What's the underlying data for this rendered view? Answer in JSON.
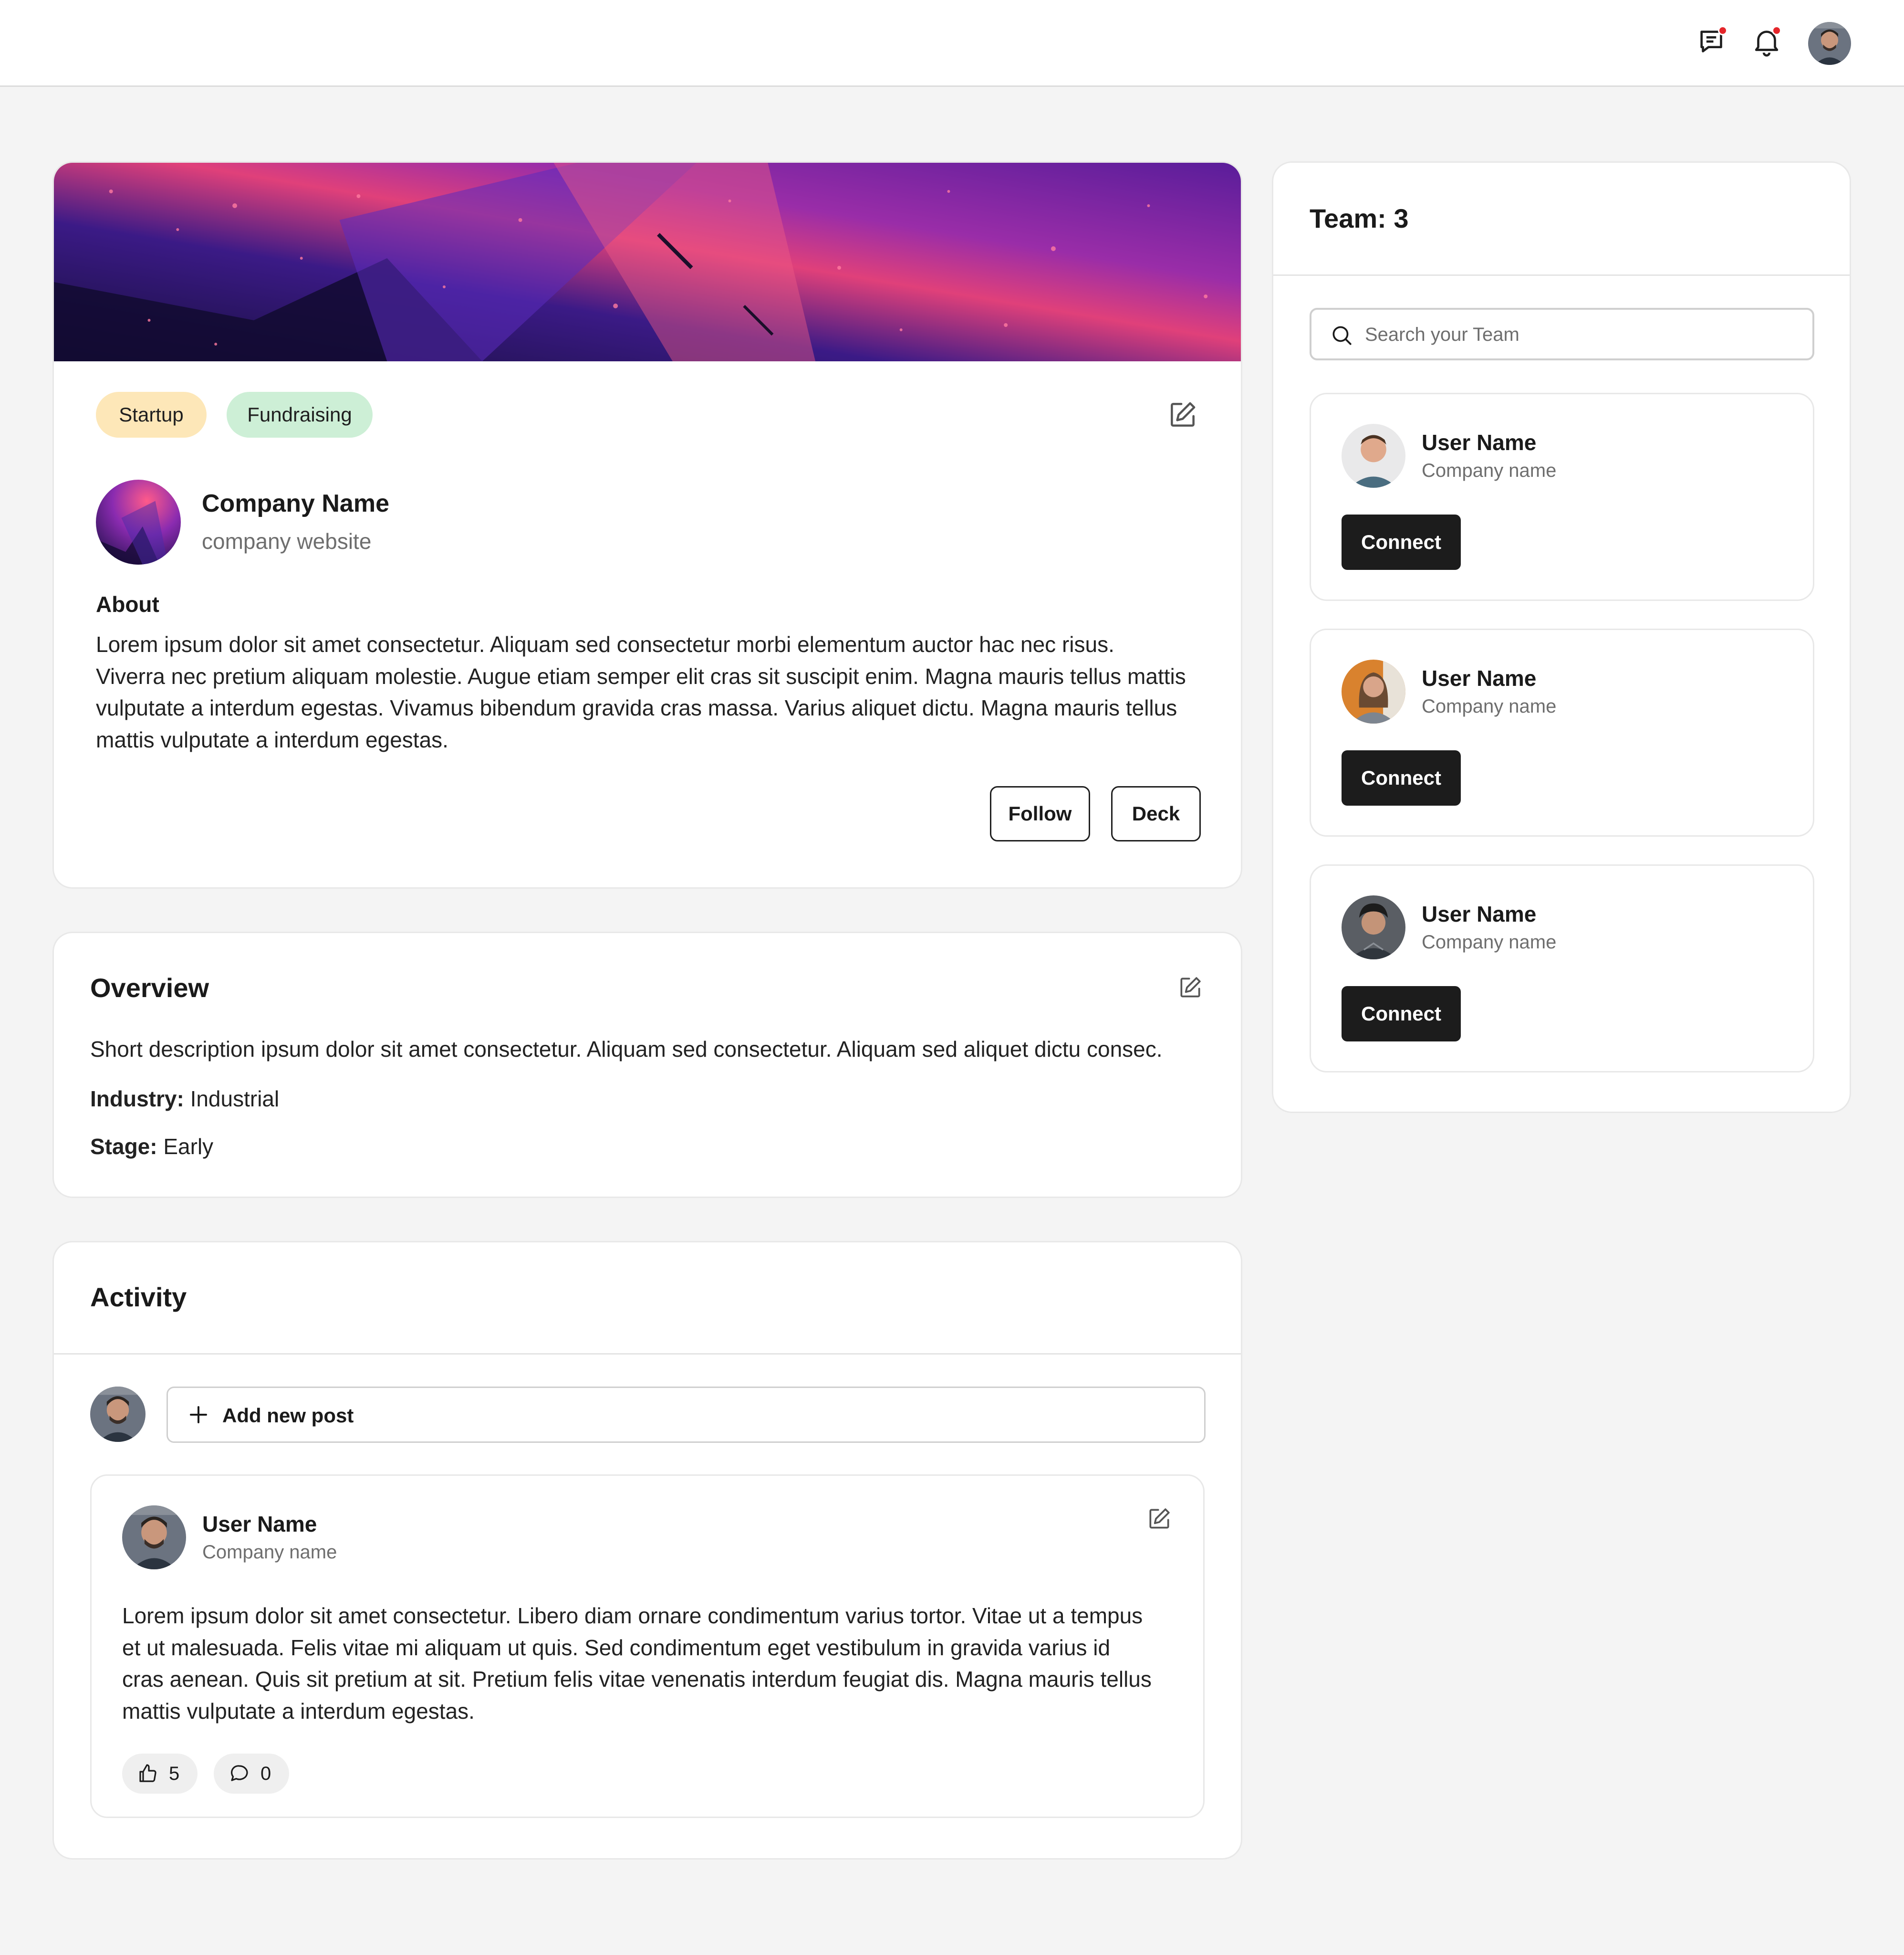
{
  "header": {
    "icons": [
      "messages-icon",
      "bell-icon"
    ],
    "notification_color": "#e5262b"
  },
  "company_card": {
    "tags": [
      {
        "label": "Startup",
        "color": "#fde7b8"
      },
      {
        "label": "Fundraising",
        "color": "#cdefd6"
      }
    ],
    "name": "Company Name",
    "website": "company website",
    "about_heading": "About",
    "about_text": "Lorem ipsum dolor sit amet consectetur. Aliquam sed consectetur morbi elementum auctor hac nec risus. Viverra nec pretium aliquam molestie. Augue etiam semper elit cras sit suscipit enim. Magna mauris tellus mattis vulputate a interdum egestas. Vivamus bibendum gravida cras massa. Varius aliquet dictu. Magna mauris tellus mattis vulputate a interdum egestas.",
    "follow_label": "Follow",
    "deck_label": "Deck"
  },
  "overview": {
    "title": "Overview",
    "description": "Short description ipsum dolor sit amet consectetur. Aliquam sed consectetur. Aliquam sed aliquet dictu consec.",
    "industry_label": "Industry:",
    "industry_value": "Industrial",
    "stage_label": "Stage:",
    "stage_value": "Early"
  },
  "activity": {
    "title": "Activity",
    "add_post_label": "Add new post",
    "post": {
      "user_name": "User Name",
      "company": "Company name",
      "text": "Lorem ipsum dolor sit amet consectetur. Libero diam ornare condimentum varius tortor. Vitae ut a tempus et ut malesuada. Felis vitae mi aliquam ut quis. Sed condimentum eget vestibulum in gravida varius id cras aenean. Quis sit pretium at sit. Pretium felis vitae venenatis interdum feugiat dis. Magna mauris tellus mattis vulputate a interdum egestas.",
      "likes": "5",
      "comments": "0"
    }
  },
  "team": {
    "title": "Team: 3",
    "search_placeholder": "Search your Team",
    "members": [
      {
        "name": "User Name",
        "company": "Company name",
        "button": "Connect"
      },
      {
        "name": "User Name",
        "company": "Company name",
        "button": "Connect"
      },
      {
        "name": "User Name",
        "company": "Company name",
        "button": "Connect"
      }
    ]
  }
}
